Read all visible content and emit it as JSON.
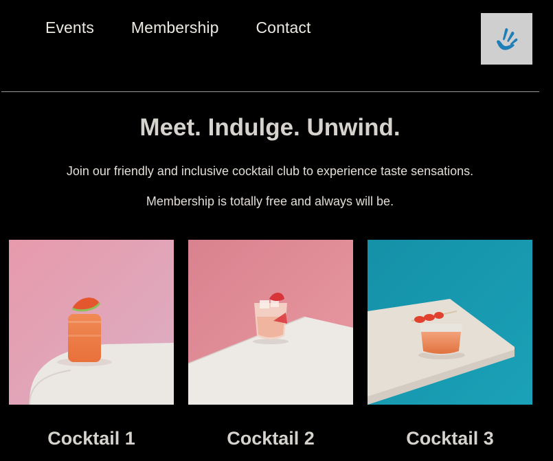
{
  "nav": {
    "items": [
      {
        "label": "Events"
      },
      {
        "label": "Membership"
      },
      {
        "label": "Contact"
      }
    ]
  },
  "accessibility_button": {
    "icon": "accessibility-hand-icon",
    "icon_color": "#1e7fb8",
    "background": "#cfcfcf"
  },
  "hero": {
    "headline": "Meet. Indulge. Unwind.",
    "line1": "Join our friendly and inclusive cocktail club to experience taste sensations.",
    "line2": "Membership is totally free and always will be."
  },
  "cards": [
    {
      "title": "Cocktail 1",
      "image": "pink-backdrop-orange-cocktail-watermelon-garnish"
    },
    {
      "title": "Cocktail 2",
      "image": "pink-backdrop-pale-cocktail-strawberry-garnish"
    },
    {
      "title": "Cocktail 3",
      "image": "teal-backdrop-orange-cocktail-strawberry-skewer"
    }
  ],
  "colors": {
    "background": "#000000",
    "text": "#d6d2cd",
    "divider": "#9a9a9a"
  }
}
